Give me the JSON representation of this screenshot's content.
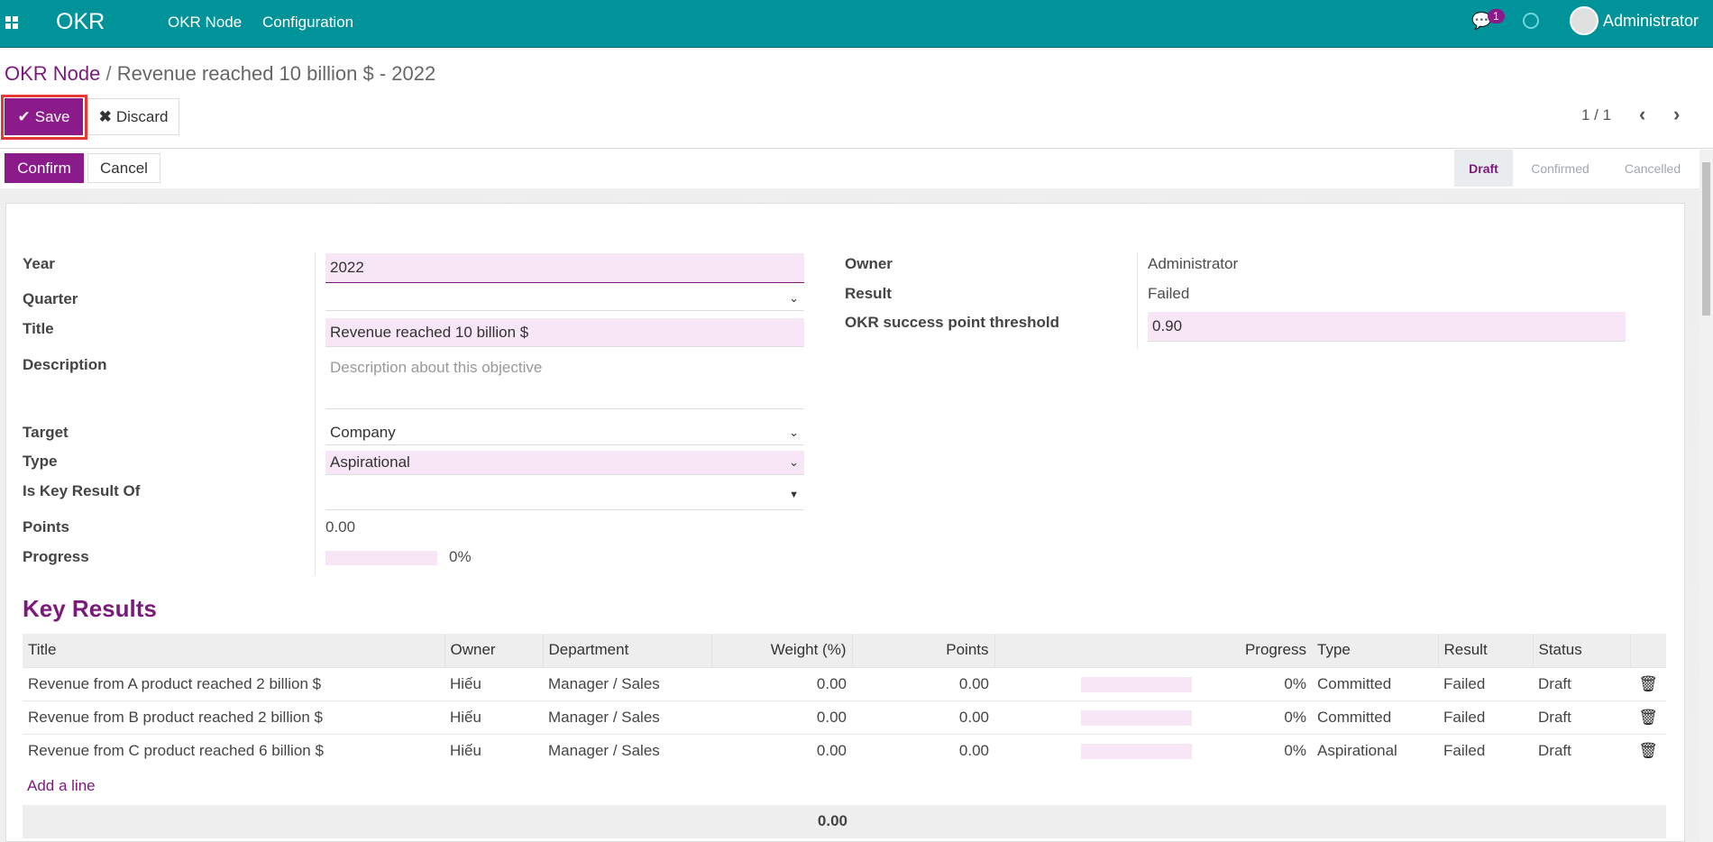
{
  "nav": {
    "app": "OKR",
    "menu": [
      "OKR Node",
      "Configuration"
    ],
    "messages_count": "1",
    "user": "Administrator"
  },
  "breadcrumb": {
    "parent": "OKR Node",
    "current": "Revenue reached 10 billion $ - 2022"
  },
  "toolbar": {
    "save": "Save",
    "discard": "Discard",
    "pager": "1 / 1"
  },
  "actions": {
    "confirm": "Confirm",
    "cancel": "Cancel"
  },
  "statusbar": {
    "stages": [
      "Draft",
      "Confirmed",
      "Cancelled"
    ],
    "active": "Draft"
  },
  "form": {
    "labels": {
      "year": "Year",
      "quarter": "Quarter",
      "title": "Title",
      "description": "Description",
      "target": "Target",
      "type": "Type",
      "key_result_of": "Is Key Result Of",
      "points": "Points",
      "progress": "Progress",
      "owner": "Owner",
      "result": "Result",
      "threshold": "OKR success point threshold"
    },
    "values": {
      "year": "2022",
      "quarter": "",
      "title": "Revenue reached 10 billion $",
      "description_placeholder": "Description about this objective",
      "target": "Company",
      "type": "Aspirational",
      "key_result_of": "",
      "points": "0.00",
      "progress": "0%",
      "progress_value": 0,
      "owner": "Administrator",
      "result": "Failed",
      "threshold": "0.90"
    }
  },
  "key_results": {
    "heading": "Key Results",
    "columns": [
      "Title",
      "Owner",
      "Department",
      "Weight (%)",
      "Points",
      "Progress",
      "Type",
      "Result",
      "Status"
    ],
    "rows": [
      {
        "title": "Revenue from A product reached 2 billion $",
        "owner": "Hiếu",
        "department": "Manager / Sales",
        "weight": "0.00",
        "points": "0.00",
        "progress": "0%",
        "type": "Committed",
        "result": "Failed",
        "status": "Draft"
      },
      {
        "title": "Revenue from B product reached 2 billion $",
        "owner": "Hiếu",
        "department": "Manager / Sales",
        "weight": "0.00",
        "points": "0.00",
        "progress": "0%",
        "type": "Committed",
        "result": "Failed",
        "status": "Draft"
      },
      {
        "title": "Revenue from C product reached 6 billion $",
        "owner": "Hiếu",
        "department": "Manager / Sales",
        "weight": "0.00",
        "points": "0.00",
        "progress": "0%",
        "type": "Aspirational",
        "result": "Failed",
        "status": "Draft"
      }
    ],
    "add_line": "Add a line",
    "total_weight": "0.00"
  },
  "colors": {
    "navbar": "#00939a",
    "primary": "#8b1a8a",
    "required_field": "#f7e6f5",
    "highlight_border": "#e53935"
  }
}
